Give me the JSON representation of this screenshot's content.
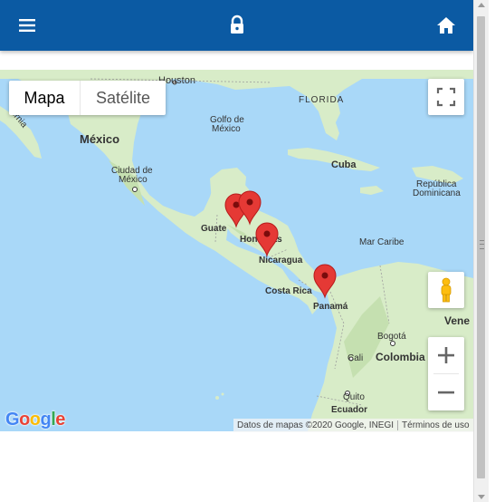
{
  "appbar": {
    "menu_icon": "hamburger-menu-icon",
    "lock_icon": "lock-icon",
    "home_icon": "home-icon",
    "bg_color": "#0b5aa3"
  },
  "map": {
    "type_control": {
      "map_label": "Mapa",
      "satellite_label": "Satélite",
      "selected": "Mapa"
    },
    "labels": {
      "houston": "Houston",
      "florida": "FLORIDA",
      "golfo": "Golfo de",
      "mexico_gulf": "México",
      "mexico": "México",
      "cdmx1": "Ciudad de",
      "cdmx2": "México",
      "cuba": "Cuba",
      "rd1": "República",
      "rd2": "Dominicana",
      "guatemala": "Guate",
      "honduras": "Honduras",
      "nicaragua": "Nicaragua",
      "mar_caribe": "Mar Caribe",
      "costa_rica": "Costa Rica",
      "panama": "Panamá",
      "venezuela": "Vene",
      "bogota": "Bogotá",
      "colombia": "Colombia",
      "cali": "Cali",
      "quito": "Quito",
      "ecuador": "Ecuador",
      "california": "ornia"
    },
    "markers": [
      {
        "name": "Guatemala"
      },
      {
        "name": "Honduras"
      },
      {
        "name": "Nicaragua"
      },
      {
        "name": "Panamá"
      }
    ],
    "attribution": {
      "data": "Datos de mapas ©2020 Google, INEGI",
      "terms": "Términos de uso"
    },
    "logo": "Google",
    "water_color": "#a9d8f8",
    "land_color": "#d8ecc8",
    "marker_color": "#e53935"
  }
}
